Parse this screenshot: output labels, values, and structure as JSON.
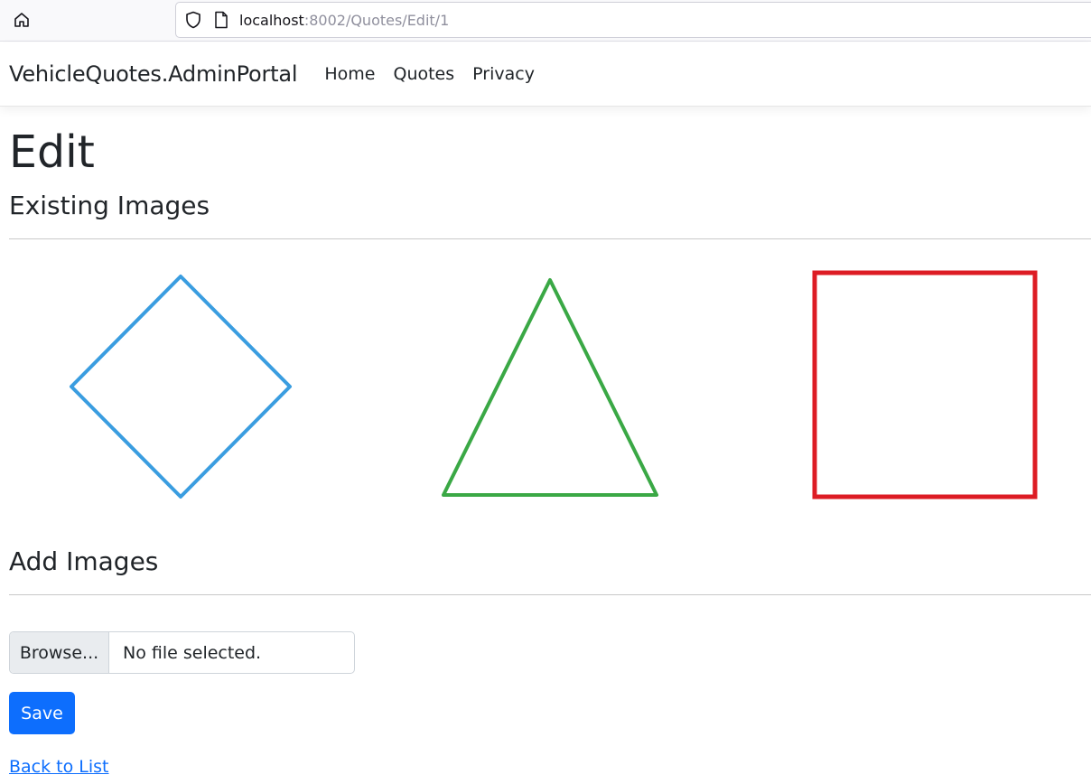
{
  "browser": {
    "url_host": "localhost",
    "url_rest": ":8002/Quotes/Edit/1",
    "icons": [
      "home-icon",
      "shield-icon",
      "page-icon"
    ]
  },
  "navbar": {
    "brand": "VehicleQuotes.AdminPortal",
    "links": [
      {
        "label": "Home"
      },
      {
        "label": "Quotes"
      },
      {
        "label": "Privacy"
      }
    ]
  },
  "page": {
    "title": "Edit",
    "existing_images_heading": "Existing Images",
    "add_images_heading": "Add Images",
    "existing_images": [
      {
        "shape": "diamond",
        "color": "#3a9de0"
      },
      {
        "shape": "triangle",
        "color": "#3aa845"
      },
      {
        "shape": "square",
        "color": "#dd1c24"
      }
    ],
    "file_input": {
      "button_label": "Browse...",
      "status": "No file selected."
    },
    "save_label": "Save",
    "back_link": "Back to List"
  },
  "colors": {
    "primary": "#0d6efd",
    "text": "#212529"
  }
}
